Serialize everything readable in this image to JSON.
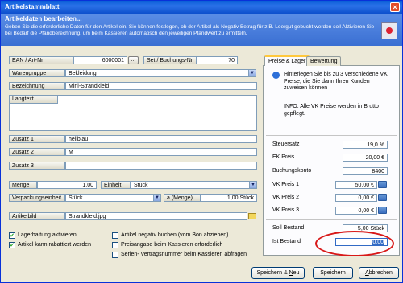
{
  "window": {
    "title": "Artikelstammblatt"
  },
  "banner": {
    "heading": "Artikeldaten bearbeiten...",
    "description": "Geben Sie die erforderliche Daten für den Artikel ein. Sie können festlegen, ob der Artikel als Negativ Betrag für z.B. Leergut gebucht werden soll Aktivieren Sie bei Bedarf die Pfandberechnung, um beim Kassieren automatisch den jeweiligen Pfandwert zu ermitteln."
  },
  "form": {
    "ean_label": "EAN / Art-Nr",
    "ean_value": "6000001",
    "ean_button": "...",
    "set_label": "Set / Buchungs-Nr",
    "set_value": "70",
    "warengruppe_label": "Warengruppe",
    "warengruppe_value": "Bekleidung",
    "bezeichnung_label": "Bezeichnung",
    "bezeichnung_value": "Mini-Strandkleid",
    "langtext_label": "Langtext",
    "langtext_value": "",
    "zusatz1_label": "Zusatz 1",
    "zusatz1_value": "hellblau",
    "zusatz2_label": "Zusatz 2",
    "zusatz2_value": "M",
    "zusatz3_label": "Zusatz 3",
    "zusatz3_value": "",
    "menge_label": "Menge",
    "menge_value": "1,00",
    "einheit_label": "Einheit",
    "einheit_value": "Stück",
    "verpackung_label": "Verpackungseinheit",
    "verpackung_value": "Stück",
    "amenge_label": "a (Menge)",
    "amenge_value": "1,00 Stück",
    "artikelbild_label": "Artikelbild",
    "artikelbild_value": "Strandkleid.jpg"
  },
  "checkboxes": {
    "lagerhaltung": {
      "label": "Lagerhaltung aktivieren",
      "checked": true,
      "mark": "✔"
    },
    "rabattiert": {
      "label": "Artikel kann rabattiert werden",
      "checked": true,
      "mark": "✔"
    },
    "negativ": {
      "label": "Artikel negativ buchen (vom Bon abziehen)",
      "checked": false,
      "mark": ""
    },
    "preisangabe": {
      "label": "Preisangabe beim Kassieren erforderlich",
      "checked": false,
      "mark": ""
    },
    "seriennummer": {
      "label": "Serien- Vertragsnummer beim Kassieren abfragen",
      "checked": false,
      "mark": ""
    }
  },
  "tabs": {
    "preise": "Preise & Lager",
    "bewertung": "Bewertung"
  },
  "panel": {
    "info1": "Hinterlegen Sie bis zu 3 verschiedene VK Preise, die Sie dann Ihren Kunden zuweisen können",
    "info2": "INFO: Alle VK Preise werden in Brutto gepflegt.",
    "steuersatz_label": "Steuersatz",
    "steuersatz_value": "19,0 %",
    "ek_label": "EK Preis",
    "ek_value": "20,00 €",
    "buchungskonto_label": "Buchungskonto",
    "buchungskonto_value": "8400",
    "vk1_label": "VK Preis 1",
    "vk1_value": "50,00 €",
    "vk2_label": "VK Preis 2",
    "vk2_value": "0,00 €",
    "vk3_label": "VK Preis 3",
    "vk3_value": "0,00 €",
    "soll_label": "Soll Bestand",
    "soll_value": "5,00 Stück",
    "ist_label": "Ist Bestand",
    "ist_value": "0,00"
  },
  "buttons": {
    "speichern_neu_pre": "Speichern & ",
    "speichern_neu_key": "N",
    "speichern_neu_post": "eu",
    "speichern": "Speichern",
    "abbrechen_key": "A",
    "abbrechen_post": "bbrechen"
  },
  "colors": {
    "highlight_ellipse": "#d81818",
    "title_bar": "#0a5fd8"
  }
}
